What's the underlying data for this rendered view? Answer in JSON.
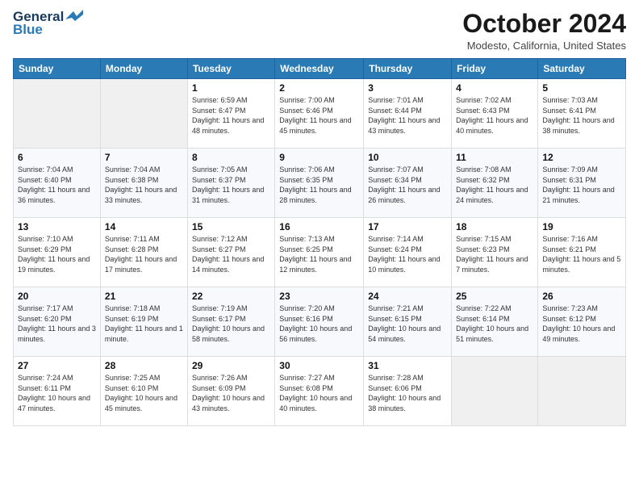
{
  "logo": {
    "line1": "General",
    "line2": "Blue"
  },
  "header": {
    "month": "October 2024",
    "location": "Modesto, California, United States"
  },
  "weekdays": [
    "Sunday",
    "Monday",
    "Tuesday",
    "Wednesday",
    "Thursday",
    "Friday",
    "Saturday"
  ],
  "weeks": [
    [
      {
        "day": "",
        "sunrise": "",
        "sunset": "",
        "daylight": ""
      },
      {
        "day": "",
        "sunrise": "",
        "sunset": "",
        "daylight": ""
      },
      {
        "day": "1",
        "sunrise": "Sunrise: 6:59 AM",
        "sunset": "Sunset: 6:47 PM",
        "daylight": "Daylight: 11 hours and 48 minutes."
      },
      {
        "day": "2",
        "sunrise": "Sunrise: 7:00 AM",
        "sunset": "Sunset: 6:46 PM",
        "daylight": "Daylight: 11 hours and 45 minutes."
      },
      {
        "day": "3",
        "sunrise": "Sunrise: 7:01 AM",
        "sunset": "Sunset: 6:44 PM",
        "daylight": "Daylight: 11 hours and 43 minutes."
      },
      {
        "day": "4",
        "sunrise": "Sunrise: 7:02 AM",
        "sunset": "Sunset: 6:43 PM",
        "daylight": "Daylight: 11 hours and 40 minutes."
      },
      {
        "day": "5",
        "sunrise": "Sunrise: 7:03 AM",
        "sunset": "Sunset: 6:41 PM",
        "daylight": "Daylight: 11 hours and 38 minutes."
      }
    ],
    [
      {
        "day": "6",
        "sunrise": "Sunrise: 7:04 AM",
        "sunset": "Sunset: 6:40 PM",
        "daylight": "Daylight: 11 hours and 36 minutes."
      },
      {
        "day": "7",
        "sunrise": "Sunrise: 7:04 AM",
        "sunset": "Sunset: 6:38 PM",
        "daylight": "Daylight: 11 hours and 33 minutes."
      },
      {
        "day": "8",
        "sunrise": "Sunrise: 7:05 AM",
        "sunset": "Sunset: 6:37 PM",
        "daylight": "Daylight: 11 hours and 31 minutes."
      },
      {
        "day": "9",
        "sunrise": "Sunrise: 7:06 AM",
        "sunset": "Sunset: 6:35 PM",
        "daylight": "Daylight: 11 hours and 28 minutes."
      },
      {
        "day": "10",
        "sunrise": "Sunrise: 7:07 AM",
        "sunset": "Sunset: 6:34 PM",
        "daylight": "Daylight: 11 hours and 26 minutes."
      },
      {
        "day": "11",
        "sunrise": "Sunrise: 7:08 AM",
        "sunset": "Sunset: 6:32 PM",
        "daylight": "Daylight: 11 hours and 24 minutes."
      },
      {
        "day": "12",
        "sunrise": "Sunrise: 7:09 AM",
        "sunset": "Sunset: 6:31 PM",
        "daylight": "Daylight: 11 hours and 21 minutes."
      }
    ],
    [
      {
        "day": "13",
        "sunrise": "Sunrise: 7:10 AM",
        "sunset": "Sunset: 6:29 PM",
        "daylight": "Daylight: 11 hours and 19 minutes."
      },
      {
        "day": "14",
        "sunrise": "Sunrise: 7:11 AM",
        "sunset": "Sunset: 6:28 PM",
        "daylight": "Daylight: 11 hours and 17 minutes."
      },
      {
        "day": "15",
        "sunrise": "Sunrise: 7:12 AM",
        "sunset": "Sunset: 6:27 PM",
        "daylight": "Daylight: 11 hours and 14 minutes."
      },
      {
        "day": "16",
        "sunrise": "Sunrise: 7:13 AM",
        "sunset": "Sunset: 6:25 PM",
        "daylight": "Daylight: 11 hours and 12 minutes."
      },
      {
        "day": "17",
        "sunrise": "Sunrise: 7:14 AM",
        "sunset": "Sunset: 6:24 PM",
        "daylight": "Daylight: 11 hours and 10 minutes."
      },
      {
        "day": "18",
        "sunrise": "Sunrise: 7:15 AM",
        "sunset": "Sunset: 6:23 PM",
        "daylight": "Daylight: 11 hours and 7 minutes."
      },
      {
        "day": "19",
        "sunrise": "Sunrise: 7:16 AM",
        "sunset": "Sunset: 6:21 PM",
        "daylight": "Daylight: 11 hours and 5 minutes."
      }
    ],
    [
      {
        "day": "20",
        "sunrise": "Sunrise: 7:17 AM",
        "sunset": "Sunset: 6:20 PM",
        "daylight": "Daylight: 11 hours and 3 minutes."
      },
      {
        "day": "21",
        "sunrise": "Sunrise: 7:18 AM",
        "sunset": "Sunset: 6:19 PM",
        "daylight": "Daylight: 11 hours and 1 minute."
      },
      {
        "day": "22",
        "sunrise": "Sunrise: 7:19 AM",
        "sunset": "Sunset: 6:17 PM",
        "daylight": "Daylight: 10 hours and 58 minutes."
      },
      {
        "day": "23",
        "sunrise": "Sunrise: 7:20 AM",
        "sunset": "Sunset: 6:16 PM",
        "daylight": "Daylight: 10 hours and 56 minutes."
      },
      {
        "day": "24",
        "sunrise": "Sunrise: 7:21 AM",
        "sunset": "Sunset: 6:15 PM",
        "daylight": "Daylight: 10 hours and 54 minutes."
      },
      {
        "day": "25",
        "sunrise": "Sunrise: 7:22 AM",
        "sunset": "Sunset: 6:14 PM",
        "daylight": "Daylight: 10 hours and 51 minutes."
      },
      {
        "day": "26",
        "sunrise": "Sunrise: 7:23 AM",
        "sunset": "Sunset: 6:12 PM",
        "daylight": "Daylight: 10 hours and 49 minutes."
      }
    ],
    [
      {
        "day": "27",
        "sunrise": "Sunrise: 7:24 AM",
        "sunset": "Sunset: 6:11 PM",
        "daylight": "Daylight: 10 hours and 47 minutes."
      },
      {
        "day": "28",
        "sunrise": "Sunrise: 7:25 AM",
        "sunset": "Sunset: 6:10 PM",
        "daylight": "Daylight: 10 hours and 45 minutes."
      },
      {
        "day": "29",
        "sunrise": "Sunrise: 7:26 AM",
        "sunset": "Sunset: 6:09 PM",
        "daylight": "Daylight: 10 hours and 43 minutes."
      },
      {
        "day": "30",
        "sunrise": "Sunrise: 7:27 AM",
        "sunset": "Sunset: 6:08 PM",
        "daylight": "Daylight: 10 hours and 40 minutes."
      },
      {
        "day": "31",
        "sunrise": "Sunrise: 7:28 AM",
        "sunset": "Sunset: 6:06 PM",
        "daylight": "Daylight: 10 hours and 38 minutes."
      },
      {
        "day": "",
        "sunrise": "",
        "sunset": "",
        "daylight": ""
      },
      {
        "day": "",
        "sunrise": "",
        "sunset": "",
        "daylight": ""
      }
    ]
  ]
}
